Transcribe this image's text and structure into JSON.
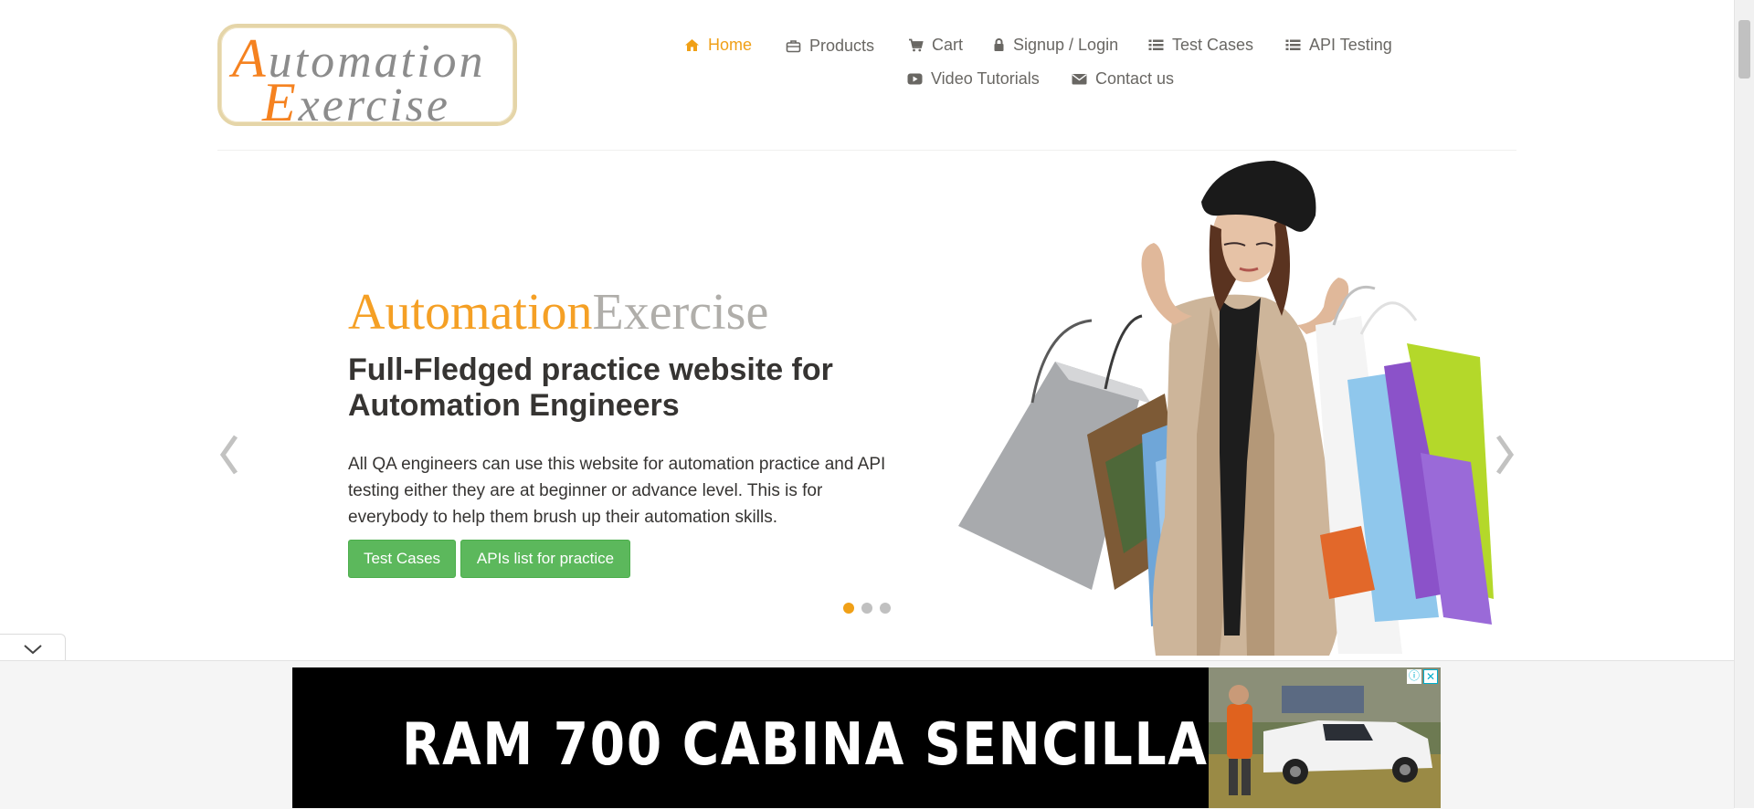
{
  "logo": {
    "line1_cap": "A",
    "line1_rest": "utomation",
    "line2_cap": "E",
    "line2_rest": "xercise"
  },
  "nav": {
    "home": "Home",
    "products": "Products",
    "cart": "Cart",
    "signup": "Signup / Login",
    "test_cases": "Test Cases",
    "api_testing": "API Testing",
    "video": "Video Tutorials",
    "contact": "Contact us",
    "active_color": "#f0a017"
  },
  "slide": {
    "brand_a": "Automation",
    "brand_b": "Exercise",
    "headline": "Full-Fledged practice website for Automation Engineers",
    "description": "All QA engineers can use this website for automation practice and API testing either they are at beginner or advance level. This is for everybody to help them brush up their automation skills.",
    "btn_test_cases": "Test Cases",
    "btn_apis": "APIs list for practice",
    "active_dot": 1,
    "dot_count": 3
  },
  "ad": {
    "headline": "RAM 700 CABINA SENCILLA",
    "info_icon": "ⓘ",
    "close_icon": "✕"
  },
  "colors": {
    "accent": "#f0a017",
    "button_green": "#5cb85c",
    "text_dark": "#363432",
    "text_nav": "#696763"
  }
}
